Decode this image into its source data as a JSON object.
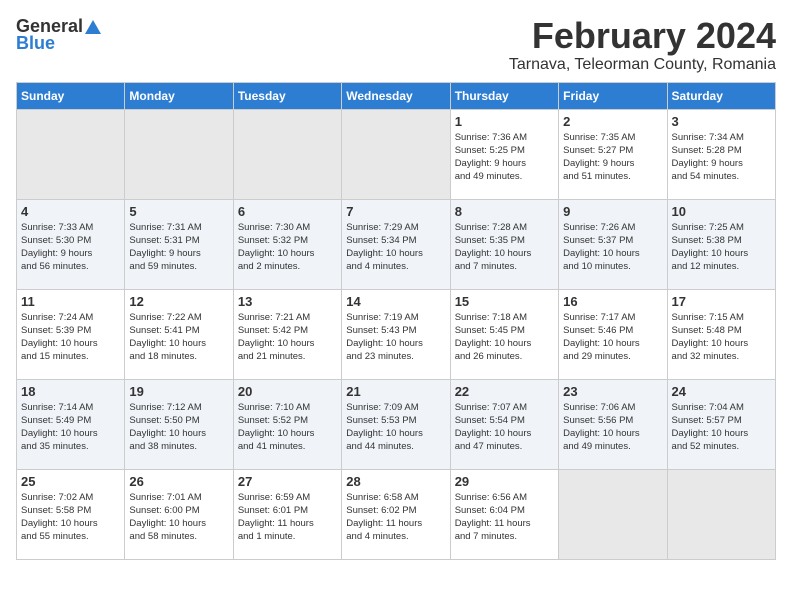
{
  "header": {
    "logo_general": "General",
    "logo_blue": "Blue",
    "month_title": "February 2024",
    "subtitle": "Tarnava, Teleorman County, Romania"
  },
  "days_of_week": [
    "Sunday",
    "Monday",
    "Tuesday",
    "Wednesday",
    "Thursday",
    "Friday",
    "Saturday"
  ],
  "weeks": [
    [
      {
        "day": "",
        "info": ""
      },
      {
        "day": "",
        "info": ""
      },
      {
        "day": "",
        "info": ""
      },
      {
        "day": "",
        "info": ""
      },
      {
        "day": "1",
        "info": "Sunrise: 7:36 AM\nSunset: 5:25 PM\nDaylight: 9 hours\nand 49 minutes."
      },
      {
        "day": "2",
        "info": "Sunrise: 7:35 AM\nSunset: 5:27 PM\nDaylight: 9 hours\nand 51 minutes."
      },
      {
        "day": "3",
        "info": "Sunrise: 7:34 AM\nSunset: 5:28 PM\nDaylight: 9 hours\nand 54 minutes."
      }
    ],
    [
      {
        "day": "4",
        "info": "Sunrise: 7:33 AM\nSunset: 5:30 PM\nDaylight: 9 hours\nand 56 minutes."
      },
      {
        "day": "5",
        "info": "Sunrise: 7:31 AM\nSunset: 5:31 PM\nDaylight: 9 hours\nand 59 minutes."
      },
      {
        "day": "6",
        "info": "Sunrise: 7:30 AM\nSunset: 5:32 PM\nDaylight: 10 hours\nand 2 minutes."
      },
      {
        "day": "7",
        "info": "Sunrise: 7:29 AM\nSunset: 5:34 PM\nDaylight: 10 hours\nand 4 minutes."
      },
      {
        "day": "8",
        "info": "Sunrise: 7:28 AM\nSunset: 5:35 PM\nDaylight: 10 hours\nand 7 minutes."
      },
      {
        "day": "9",
        "info": "Sunrise: 7:26 AM\nSunset: 5:37 PM\nDaylight: 10 hours\nand 10 minutes."
      },
      {
        "day": "10",
        "info": "Sunrise: 7:25 AM\nSunset: 5:38 PM\nDaylight: 10 hours\nand 12 minutes."
      }
    ],
    [
      {
        "day": "11",
        "info": "Sunrise: 7:24 AM\nSunset: 5:39 PM\nDaylight: 10 hours\nand 15 minutes."
      },
      {
        "day": "12",
        "info": "Sunrise: 7:22 AM\nSunset: 5:41 PM\nDaylight: 10 hours\nand 18 minutes."
      },
      {
        "day": "13",
        "info": "Sunrise: 7:21 AM\nSunset: 5:42 PM\nDaylight: 10 hours\nand 21 minutes."
      },
      {
        "day": "14",
        "info": "Sunrise: 7:19 AM\nSunset: 5:43 PM\nDaylight: 10 hours\nand 23 minutes."
      },
      {
        "day": "15",
        "info": "Sunrise: 7:18 AM\nSunset: 5:45 PM\nDaylight: 10 hours\nand 26 minutes."
      },
      {
        "day": "16",
        "info": "Sunrise: 7:17 AM\nSunset: 5:46 PM\nDaylight: 10 hours\nand 29 minutes."
      },
      {
        "day": "17",
        "info": "Sunrise: 7:15 AM\nSunset: 5:48 PM\nDaylight: 10 hours\nand 32 minutes."
      }
    ],
    [
      {
        "day": "18",
        "info": "Sunrise: 7:14 AM\nSunset: 5:49 PM\nDaylight: 10 hours\nand 35 minutes."
      },
      {
        "day": "19",
        "info": "Sunrise: 7:12 AM\nSunset: 5:50 PM\nDaylight: 10 hours\nand 38 minutes."
      },
      {
        "day": "20",
        "info": "Sunrise: 7:10 AM\nSunset: 5:52 PM\nDaylight: 10 hours\nand 41 minutes."
      },
      {
        "day": "21",
        "info": "Sunrise: 7:09 AM\nSunset: 5:53 PM\nDaylight: 10 hours\nand 44 minutes."
      },
      {
        "day": "22",
        "info": "Sunrise: 7:07 AM\nSunset: 5:54 PM\nDaylight: 10 hours\nand 47 minutes."
      },
      {
        "day": "23",
        "info": "Sunrise: 7:06 AM\nSunset: 5:56 PM\nDaylight: 10 hours\nand 49 minutes."
      },
      {
        "day": "24",
        "info": "Sunrise: 7:04 AM\nSunset: 5:57 PM\nDaylight: 10 hours\nand 52 minutes."
      }
    ],
    [
      {
        "day": "25",
        "info": "Sunrise: 7:02 AM\nSunset: 5:58 PM\nDaylight: 10 hours\nand 55 minutes."
      },
      {
        "day": "26",
        "info": "Sunrise: 7:01 AM\nSunset: 6:00 PM\nDaylight: 10 hours\nand 58 minutes."
      },
      {
        "day": "27",
        "info": "Sunrise: 6:59 AM\nSunset: 6:01 PM\nDaylight: 11 hours\nand 1 minute."
      },
      {
        "day": "28",
        "info": "Sunrise: 6:58 AM\nSunset: 6:02 PM\nDaylight: 11 hours\nand 4 minutes."
      },
      {
        "day": "29",
        "info": "Sunrise: 6:56 AM\nSunset: 6:04 PM\nDaylight: 11 hours\nand 7 minutes."
      },
      {
        "day": "",
        "info": ""
      },
      {
        "day": "",
        "info": ""
      }
    ]
  ]
}
